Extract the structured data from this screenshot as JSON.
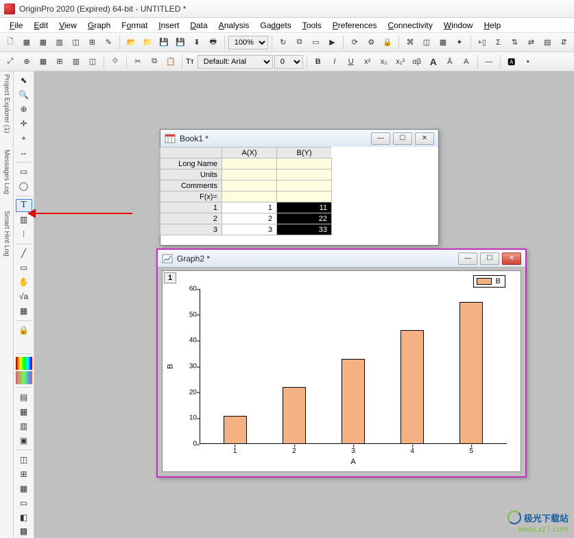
{
  "app": {
    "title": "OriginPro 2020 (Expired) 64-bit - UNTITLED *"
  },
  "menu": [
    "File",
    "Edit",
    "View",
    "Graph",
    "Format",
    "Insert",
    "Data",
    "Analysis",
    "Gadgets",
    "Tools",
    "Preferences",
    "Connectivity",
    "Window",
    "Help"
  ],
  "toolbar": {
    "zoom": "100%",
    "font_label": "Default: Arial",
    "font_size": "0",
    "bold": "B",
    "italic": "I",
    "underline": "U",
    "sup": "x²",
    "sub": "x₂",
    "subsup": "x₁²",
    "alpha": "αβ",
    "bigA": "A",
    "Ahat": "Ā",
    "Aplus": "A"
  },
  "rails": {
    "project_explorer": "Project Explorer (1)",
    "messages_log": "Messages Log",
    "smart_hint": "Smart Hint Log"
  },
  "tools": {
    "pointer": "⬉",
    "zoomin": "🔍",
    "reader": "⊕",
    "target": "✛",
    "crosshair": "⌖",
    "ruler": "↔",
    "region": "▭",
    "lasso": "◯",
    "text": "T",
    "mask": "▥",
    "draw": "⁞",
    "line": "╱",
    "rect": "▭",
    "hand": "✋",
    "calc": "√a",
    "objmgr": "▦",
    "lock": "🔒"
  },
  "tools2": {
    "t1": "▤",
    "t2": "▦",
    "t3": "▥",
    "t4": "▣",
    "t5": "◫",
    "t6": "⊞",
    "t7": "▦",
    "t8": "▭",
    "t9": "◧",
    "t10": "▩"
  },
  "book1": {
    "title": "Book1 *",
    "col_a": "A(X)",
    "col_b": "B(Y)",
    "rows": {
      "longname": "Long Name",
      "units": "Units",
      "comments": "Comments",
      "fx": "F(x)="
    },
    "data_rows": [
      {
        "n": "1",
        "a": "1",
        "b": "11"
      },
      {
        "n": "2",
        "a": "2",
        "b": "22"
      },
      {
        "n": "3",
        "a": "3",
        "b": "33"
      }
    ]
  },
  "graph2": {
    "title": "Graph2 *",
    "page_num": "1",
    "legend": "B"
  },
  "chart_data": {
    "type": "bar",
    "categories": [
      "1",
      "2",
      "3",
      "4",
      "5"
    ],
    "values": [
      11,
      22,
      33,
      44,
      55
    ],
    "xlabel": "A",
    "ylabel": "B",
    "ylim": [
      0,
      60
    ],
    "yticks": [
      0,
      10,
      20,
      30,
      40,
      50,
      60
    ],
    "series_name": "B"
  },
  "watermark": {
    "line1": "极光下载站",
    "line2": "www.xz7.com"
  },
  "window_controls": {
    "min": "—",
    "max": "☐",
    "close": "✕"
  }
}
